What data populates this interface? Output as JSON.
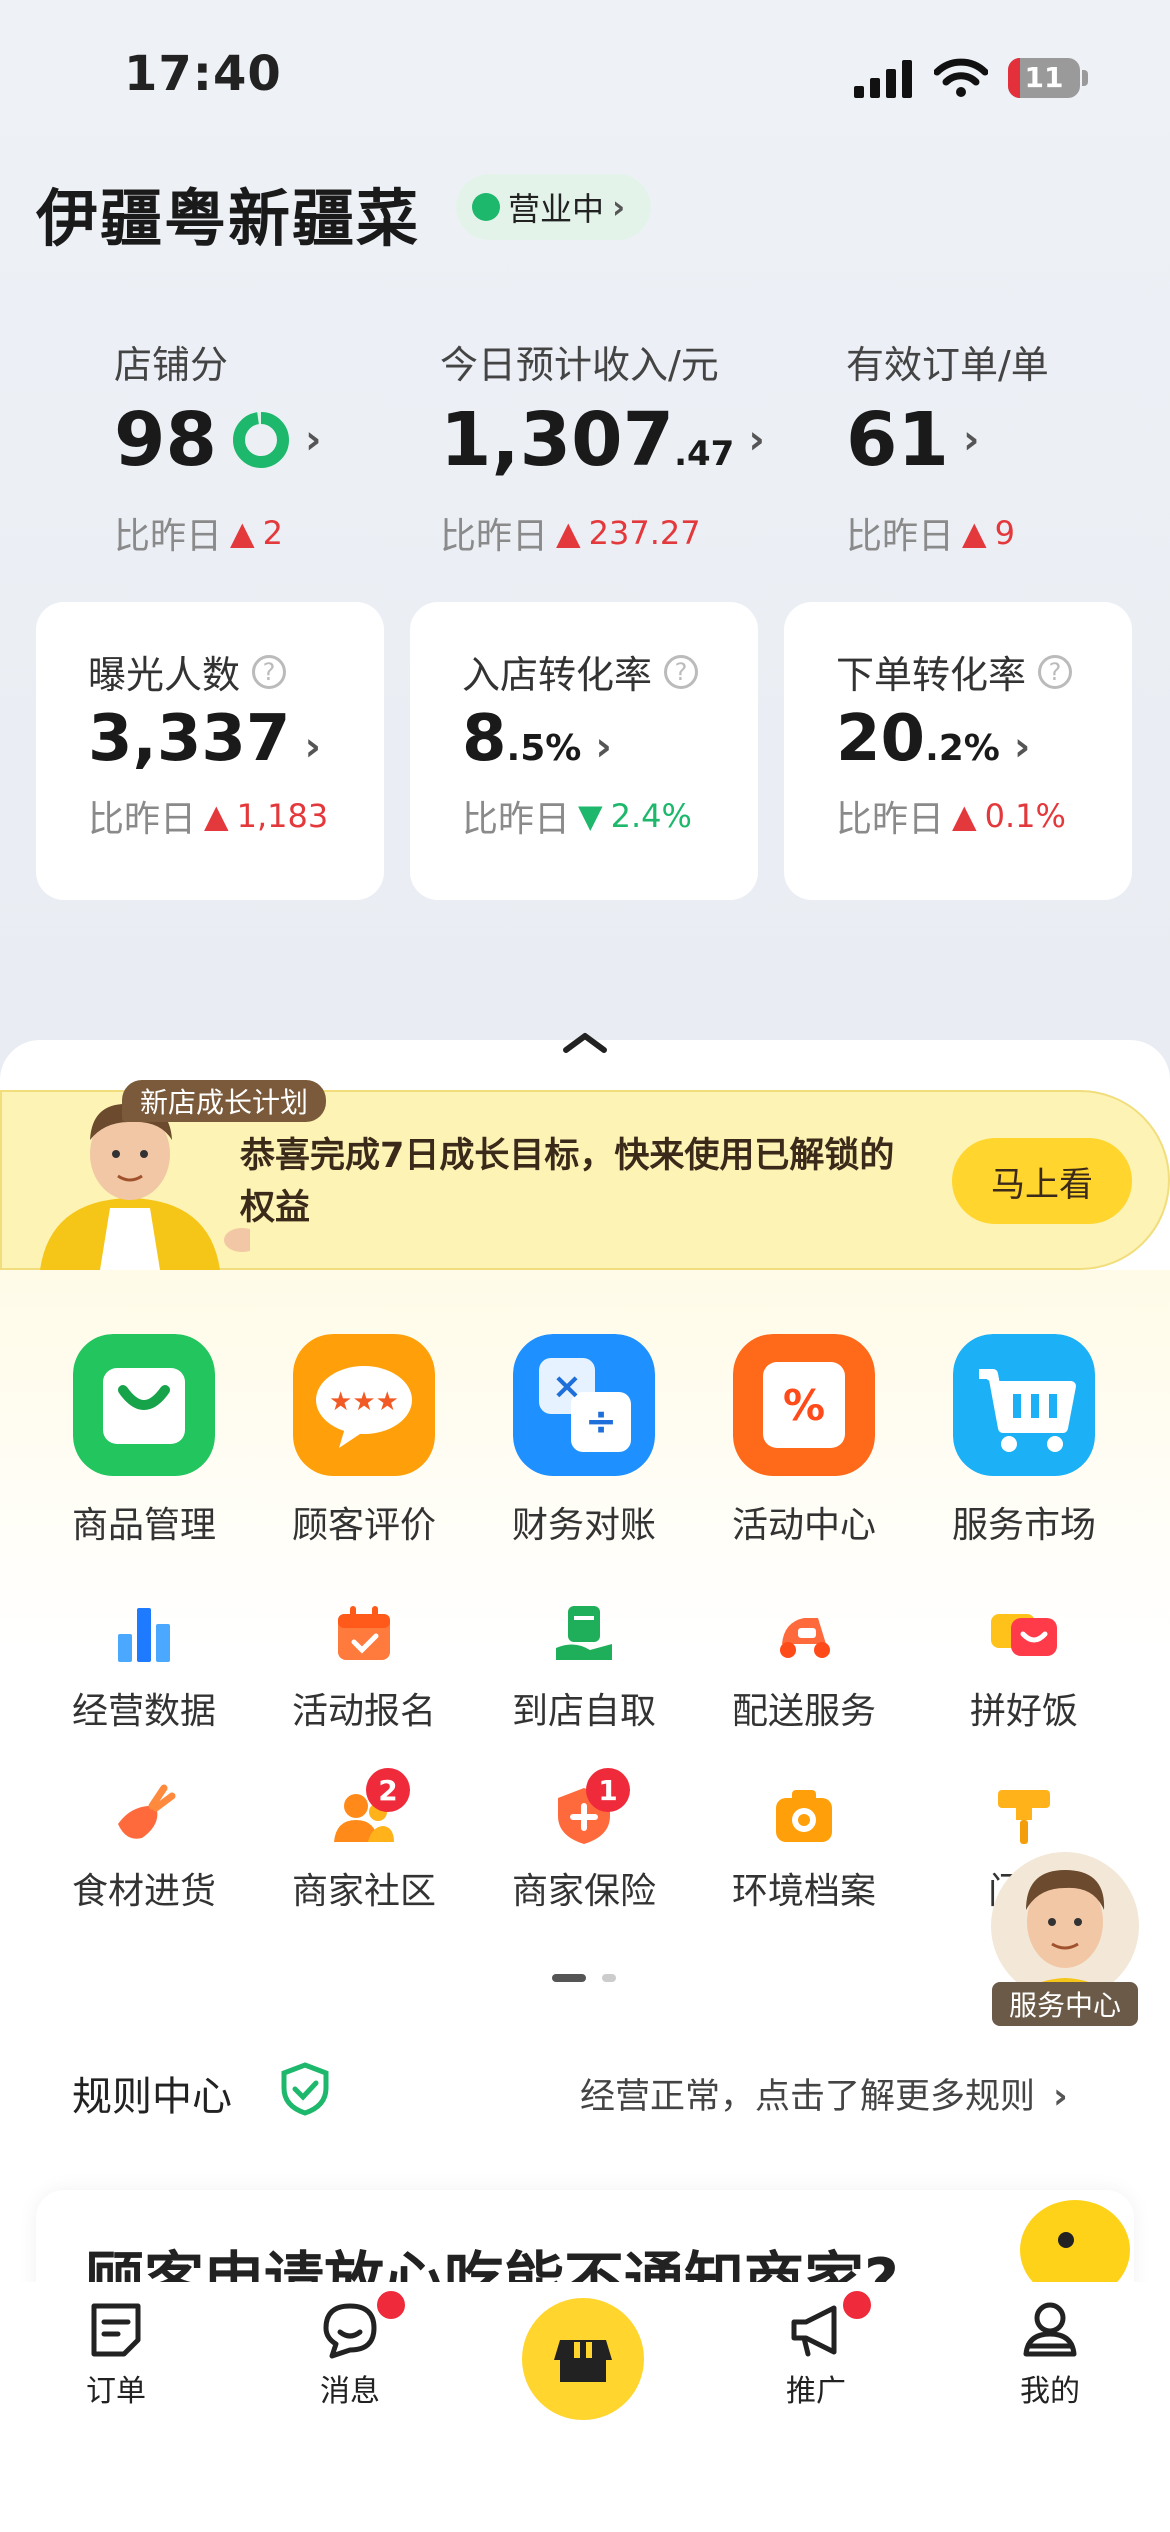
{
  "status_bar": {
    "time": "17:40",
    "battery": "11"
  },
  "store": {
    "name": "伊疆粤新疆菜",
    "status": "营业中"
  },
  "metrics": [
    {
      "label": "店铺分",
      "value": "98",
      "compare_label": "比昨日",
      "change": "2",
      "direction": "up"
    },
    {
      "label": "今日预计收入/元",
      "value_main": "1,307",
      "value_decimal": ".47",
      "compare_label": "比昨日",
      "change": "237.27",
      "direction": "up"
    },
    {
      "label": "有效订单/单",
      "value": "61",
      "compare_label": "比昨日",
      "change": "9",
      "direction": "up"
    }
  ],
  "cards": [
    {
      "label": "曝光人数",
      "value_main": "3,337",
      "value_suffix": "",
      "compare_label": "比昨日",
      "change": "1,183",
      "direction": "up"
    },
    {
      "label": "入店转化率",
      "value_main": "8",
      "value_suffix": ".5%",
      "compare_label": "比昨日",
      "change": "2.4%",
      "direction": "down"
    },
    {
      "label": "下单转化率",
      "value_main": "20",
      "value_suffix": ".2%",
      "compare_label": "比昨日",
      "change": "0.1%",
      "direction": "up"
    }
  ],
  "banner": {
    "tag": "新店成长计划",
    "text": "恭喜完成7日成长目标，快来使用已解锁的权益",
    "button": "马上看"
  },
  "primary_tools": [
    {
      "label": "商品管理",
      "icon": "shopping-bag-icon",
      "color": "#22c55e"
    },
    {
      "label": "顾客评价",
      "icon": "rating-chat-icon",
      "color": "#ff9f0a"
    },
    {
      "label": "财务对账",
      "icon": "calculator-icon",
      "color": "#1e90ff"
    },
    {
      "label": "活动中心",
      "icon": "coupon-icon",
      "color": "#ff6a1a"
    },
    {
      "label": "服务市场",
      "icon": "cart-icon",
      "color": "#1cb0f6"
    }
  ],
  "secondary_tools_row1": [
    {
      "label": "经营数据",
      "icon": "bar-chart-icon"
    },
    {
      "label": "活动报名",
      "icon": "calendar-check-icon"
    },
    {
      "label": "到店自取",
      "icon": "pickup-icon"
    },
    {
      "label": "配送服务",
      "icon": "scooter-icon"
    },
    {
      "label": "拼好饭",
      "icon": "group-meal-icon"
    }
  ],
  "secondary_tools_row2": [
    {
      "label": "食材进货",
      "icon": "carrot-icon",
      "badge": ""
    },
    {
      "label": "商家社区",
      "icon": "community-icon",
      "badge": "2"
    },
    {
      "label": "商家保险",
      "icon": "shield-plus-icon",
      "badge": "1"
    },
    {
      "label": "环境档案",
      "icon": "camera-icon",
      "badge": ""
    },
    {
      "label": "门店",
      "icon": "brush-icon",
      "badge": ""
    }
  ],
  "service_center": {
    "label": "服务中心"
  },
  "rules": {
    "title": "规则中心",
    "desc": "经营正常，点击了解更多规则"
  },
  "article": {
    "title": "顾客申请放心吃能不通知商家?"
  },
  "tabbar": [
    {
      "label": "订单",
      "icon": "order-icon",
      "dot": false
    },
    {
      "label": "消息",
      "icon": "message-icon",
      "dot": true
    },
    {
      "label": "",
      "icon": "store-icon",
      "dot": false
    },
    {
      "label": "推广",
      "icon": "megaphone-icon",
      "dot": true
    },
    {
      "label": "我的",
      "icon": "profile-icon",
      "dot": false
    }
  ]
}
